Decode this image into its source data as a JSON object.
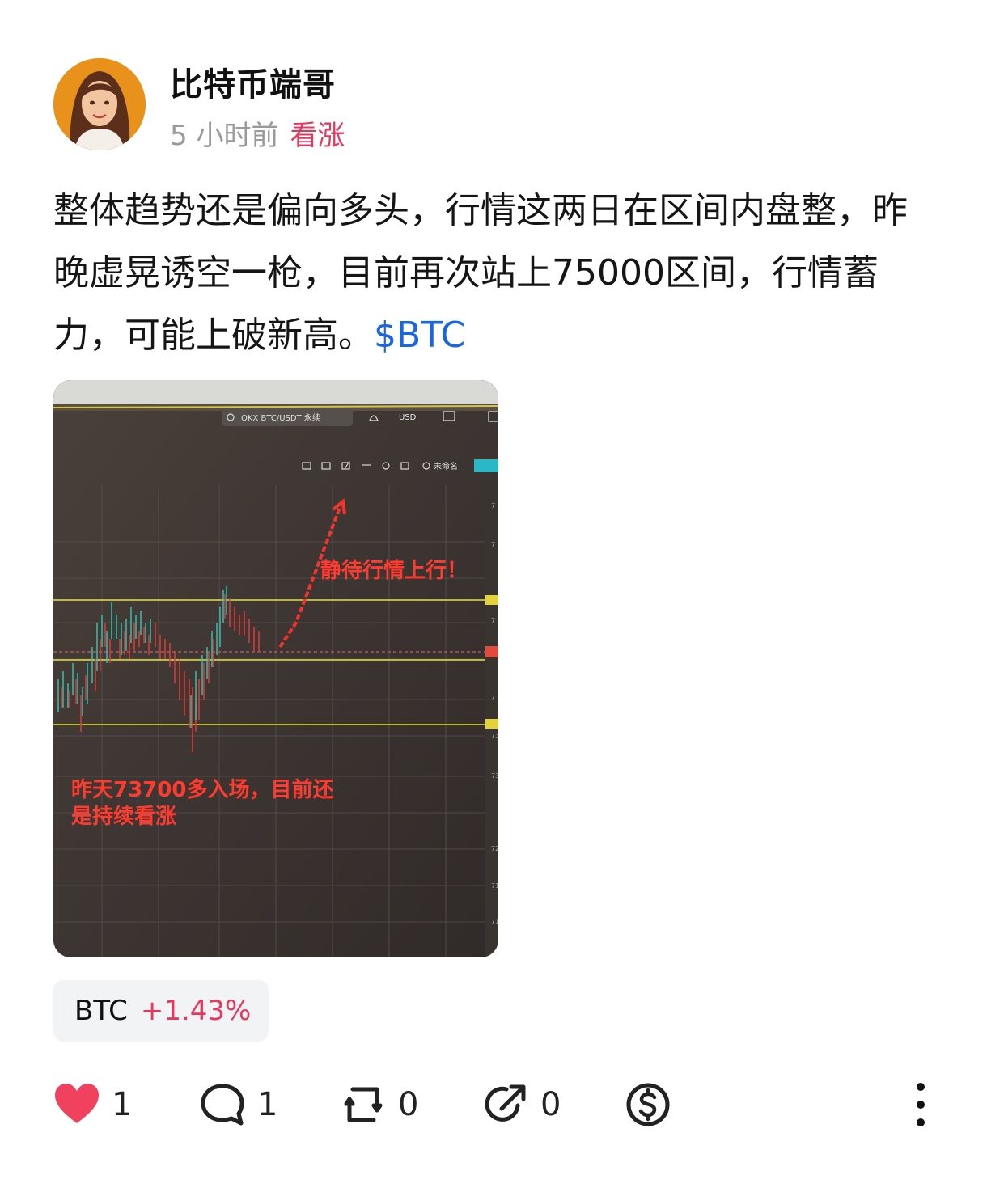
{
  "post": {
    "author": "比特币端哥",
    "time": "5 小时前",
    "sentiment": "看涨",
    "text": "整体趋势还是偏向多头，行情这两日在区间内盘整，昨晚虚晃诱空一枪，目前再次站上75000区间，行情蓄力，可能上破新高。",
    "tag": "$BTC"
  },
  "image": {
    "search_text": "OKX BTC/USDT 永续",
    "currency": "USD",
    "toolbar_label": "未命名",
    "annotation_up": "静待行情上行！",
    "annotation_bottom_line1": "昨天73700多入场，目前还",
    "annotation_bottom_line2": "是持续看涨"
  },
  "ticker": {
    "symbol": "BTC",
    "change": "+1.43%"
  },
  "actions": {
    "likes": "1",
    "comments": "1",
    "reposts": "0",
    "shares": "0"
  },
  "colors": {
    "accent_red": "#e8365d",
    "link_blue": "#1a66e0",
    "heart": "#f0415e"
  }
}
